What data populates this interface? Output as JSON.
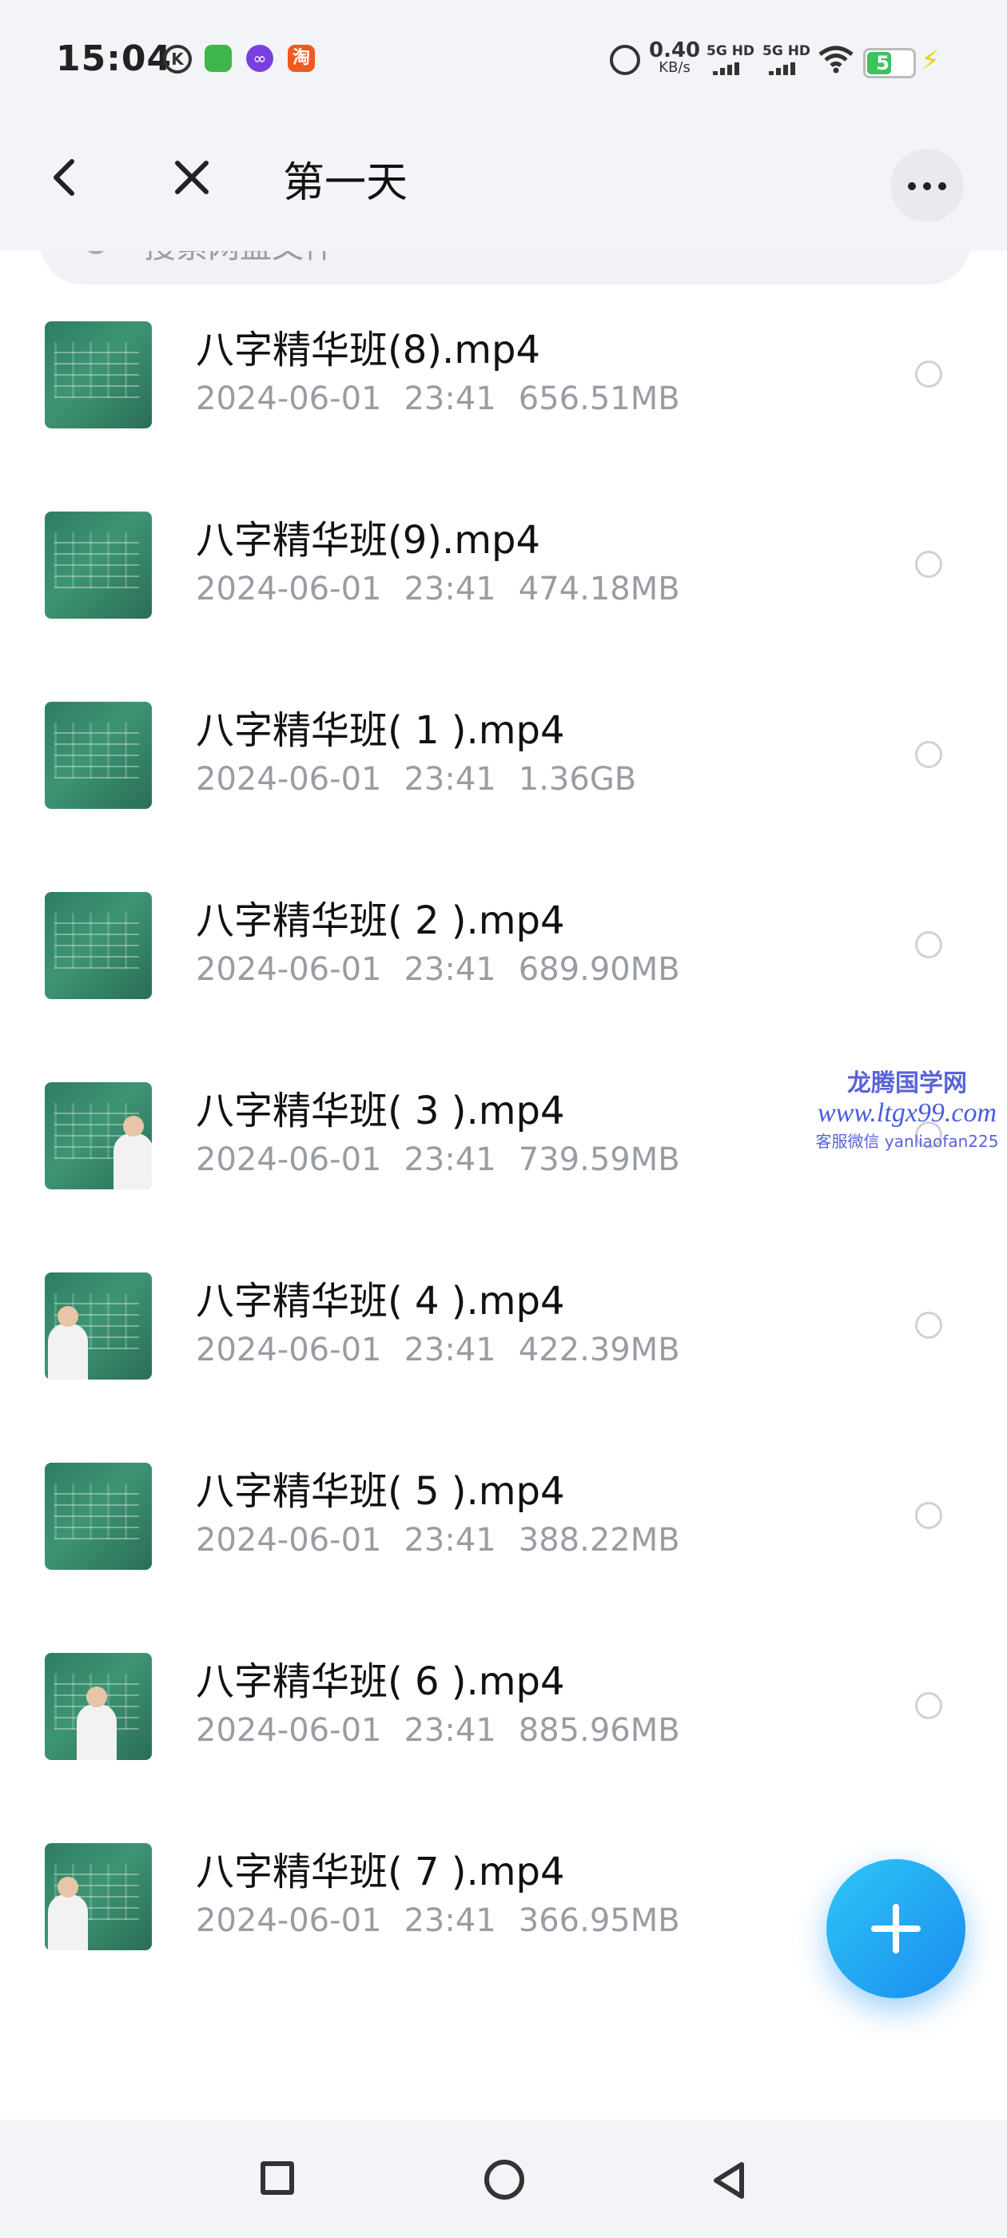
{
  "status_bar": {
    "time": "15:04",
    "app_icons": [
      "k-icon",
      "game-app-icon",
      "infinity-app-icon",
      "taobao-app-icon"
    ],
    "taobao_glyph": "淘",
    "k_glyph": "K",
    "net_speed_value": "0.40",
    "net_speed_unit": "KB/s",
    "sim1": "5G HD",
    "sim2": "5G HD",
    "battery_level": "55",
    "battery_fraction": 0.55
  },
  "header": {
    "title": "第一天"
  },
  "search": {
    "placeholder": "搜索网盘文件"
  },
  "files": [
    {
      "name": "八字精华班(8).mp4",
      "date": "2024-06-01",
      "time": "23:41",
      "size": "656.51MB"
    },
    {
      "name": "八字精华班(9).mp4",
      "date": "2024-06-01",
      "time": "23:41",
      "size": "474.18MB"
    },
    {
      "name": "八字精华班( 1 ).mp4",
      "date": "2024-06-01",
      "time": "23:41",
      "size": "1.36GB"
    },
    {
      "name": "八字精华班( 2 ).mp4",
      "date": "2024-06-01",
      "time": "23:41",
      "size": "689.90MB"
    },
    {
      "name": "八字精华班( 3 ).mp4",
      "date": "2024-06-01",
      "time": "23:41",
      "size": "739.59MB"
    },
    {
      "name": "八字精华班( 4 ).mp4",
      "date": "2024-06-01",
      "time": "23:41",
      "size": "422.39MB"
    },
    {
      "name": "八字精华班( 5 ).mp4",
      "date": "2024-06-01",
      "time": "23:41",
      "size": "388.22MB"
    },
    {
      "name": "八字精华班( 6 ).mp4",
      "date": "2024-06-01",
      "time": "23:41",
      "size": "885.96MB"
    },
    {
      "name": "八字精华班( 7 ).mp4",
      "date": "2024-06-01",
      "time": "23:41",
      "size": "366.95MB"
    }
  ],
  "watermark": {
    "line1": "龙腾国学网",
    "line2": "www.ltgx99.com",
    "line3": "客服微信 yanliaofan225"
  },
  "colors": {
    "accent": "#1a8cf0",
    "secondary_text": "#9a9ca3",
    "background": "#ffffff",
    "header_bg": "#f3f4f7"
  }
}
